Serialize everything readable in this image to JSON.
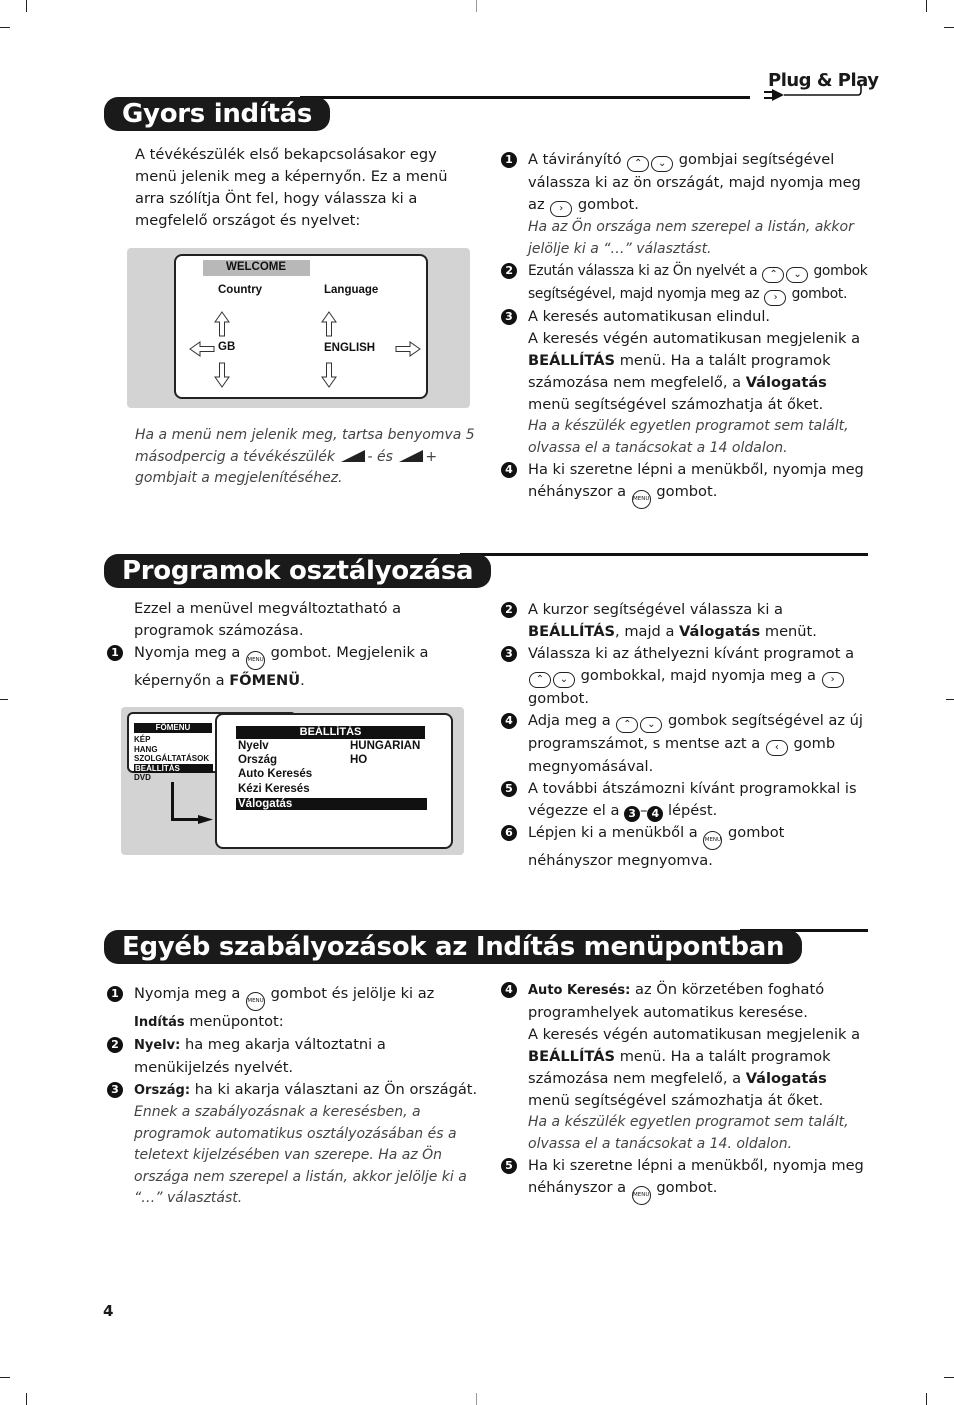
{
  "page_number": "4",
  "badge": {
    "label": "Plug & Play",
    "icon": "plug-icon"
  },
  "sections": [
    {
      "title": "Gyors indítás",
      "intro": "A tévékészülék első bekapcsolásakor egy menü jelenik meg a képernyőn. Ez a menü arra szólítja Önt fel, hogy válassza ki a megfelelő országot és nyelvet:",
      "screen": {
        "title": "WELCOME",
        "col1_label": "Country",
        "col2_label": "Language",
        "col1_value": "GB",
        "col2_value": "ENGLISH"
      },
      "note": "Ha a menü nem jelenik meg, tartsa benyomva 5 másodpercig a tévékészülék",
      "note_mid": "- és",
      "note_end": "+",
      "note_tail": "gombjait a megjelenítéséhez.",
      "steps": [
        {
          "n": "1",
          "pre": "A távirányító",
          "mid": "gombjai segítségével válassza ki az ön országát, majd nyomja meg az",
          "post": "gombot.",
          "note": "Ha az Ön országa nem szerepel a listán, akkor jelölje ki a “…” választást."
        },
        {
          "n": "2",
          "pre": "Ezután válassza ki az Ön nyelvét a",
          "mid": "gombok segítségével, majd nyomja meg az",
          "post": "gombot."
        },
        {
          "n": "3",
          "text": "A keresés automatikusan elindul.",
          "line2_pre": "A keresés végén automatikusan megjelenik a",
          "bold1": "BEÁLLÍTÁS",
          "line2_mid": "menü. Ha a talált programok számozása nem megfelelő, a",
          "bold2": "Válogatás",
          "line2_post": "menü segítségével számozhatja át őket.",
          "note": "Ha a készülék egyetlen programot sem talált, olvassa el a tanácsokat a 14 oldalon."
        },
        {
          "n": "4",
          "pre": "Ha ki szeretne lépni a menükből, nyomja meg néhányszor a",
          "post": "gombot."
        }
      ]
    },
    {
      "title": "Programok osztályozása",
      "intro": "Ezzel a menüvel megváltoztatható a programok számozása.",
      "step1": {
        "n": "1",
        "pre": "Nyomja meg a",
        "mid": "gombot. Megjelenik a képernyőn a",
        "bold": "FŐMENÜ",
        "post": "."
      },
      "screen": {
        "main_title": "FŐMENU",
        "main_items": [
          "KÉP",
          "HANG",
          "SZOLGÁLTATÁSOK",
          "BEÁLLÍTÁS",
          "DVD"
        ],
        "main_selected": "BEÁLLÍTÁS",
        "sub_title": "BEÁLLÍTÁS",
        "sub_items": [
          {
            "label": "Nyelv",
            "value": "HUNGARIAN"
          },
          {
            "label": "Ország",
            "value": "HO"
          },
          {
            "label": "Auto Keresés",
            "value": ""
          },
          {
            "label": "Kézi Keresés",
            "value": ""
          },
          {
            "label": "Válogatás",
            "value": ""
          }
        ],
        "sub_selected": "Válogatás"
      },
      "steps": [
        {
          "n": "2",
          "pre": "A kurzor segítségével válassza ki a",
          "bold1": "BEÁLLÍTÁS",
          "mid": ", majd a",
          "bold2": "Válogatás",
          "post": "menüt."
        },
        {
          "n": "3",
          "pre": "Válassza ki az áthelyezni kívánt programot a",
          "mid": "gombokkal, majd nyomja meg a",
          "post": "gombot."
        },
        {
          "n": "4",
          "pre": "Adja meg a",
          "mid": "gombok segítségével az új programszámot, s mentse azt a",
          "post": "gomb megnyomásával."
        },
        {
          "n": "5",
          "pre": "A további átszámozni kívánt programokkal is végezze el a",
          "r1": "3",
          "dash": "–",
          "r2": "4",
          "post": "lépést."
        },
        {
          "n": "6",
          "pre": "Lépjen ki a menükből a",
          "post": "gombot néhányszor megnyomva."
        }
      ]
    },
    {
      "title": "Egyéb szabályozások az Indítás menüpontban",
      "steps": [
        {
          "n": "1",
          "pre": "Nyomja meg a",
          "mid": "gombot és jelölje ki az",
          "bold": "Indítás",
          "post": "menüpontot:"
        },
        {
          "n": "2",
          "bold": "Nyelv:",
          "text": "ha meg akarja változtatni a menükijelzés nyelvét."
        },
        {
          "n": "3",
          "bold": "Ország:",
          "text": "ha ki akarja választani az Ön országát.",
          "note": "Ennek a szabályozásnak a keresésben, a programok automatikus osztályozásában és a teletext kijelzésében van szerepe. Ha az Ön országa nem szerepel a listán, akkor jelölje ki a “…” választást."
        },
        {
          "n": "4",
          "bold": "Auto Keresés:",
          "text": "az Ön körzetében fogható programhelyek automatikus keresése.",
          "line2_pre": "A keresés végén automatikusan megjelenik a",
          "bold1": "BEÁLLÍTÁS",
          "line2_mid": "menü. Ha a talált programok számozása nem megfelelő, a",
          "bold2": "Válogatás",
          "line2_post": "menü segítségével számozhatja át őket.",
          "note": "Ha a készülék egyetlen programot sem talált, olvassa el a tanácsokat a 14. oldalon."
        },
        {
          "n": "5",
          "pre": "Ha ki szeretne lépni a menükből, nyomja meg néhányszor a",
          "post": "gombot."
        }
      ]
    }
  ],
  "keys": {
    "up": "⌃",
    "down": "⌄",
    "right": "›",
    "left": "‹",
    "menu": "MENU"
  }
}
